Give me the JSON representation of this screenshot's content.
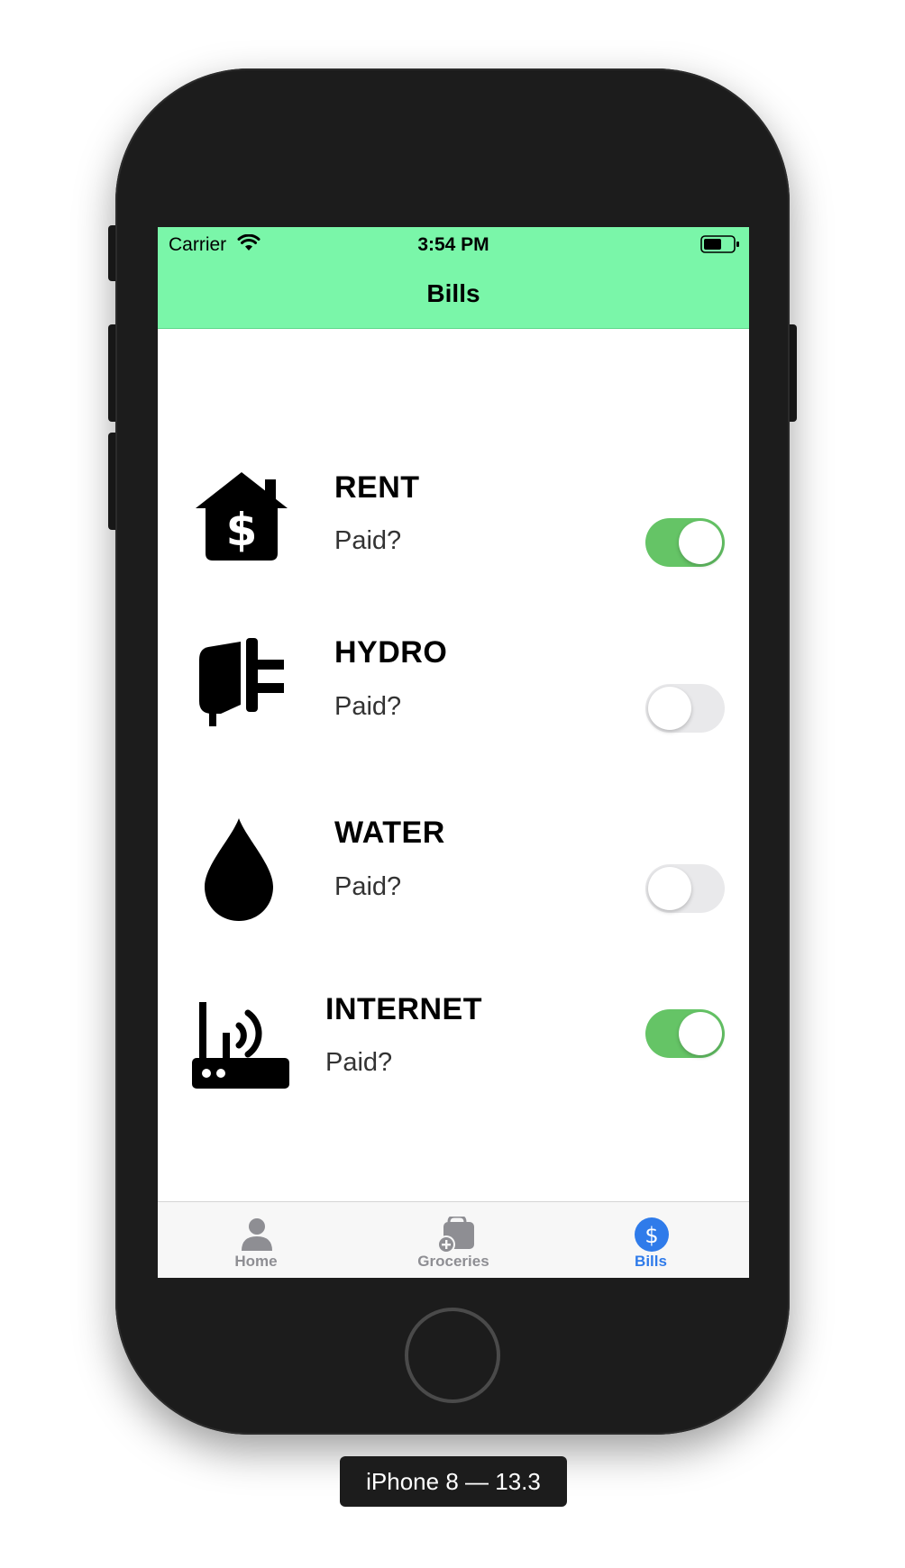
{
  "status_bar": {
    "carrier": "Carrier",
    "time": "3:54 PM"
  },
  "nav": {
    "title": "Bills"
  },
  "bills": [
    {
      "name": "RENT",
      "paid_label": "Paid?",
      "paid": true,
      "icon": "house-dollar-icon"
    },
    {
      "name": "HYDRO",
      "paid_label": "Paid?",
      "paid": false,
      "icon": "plug-icon"
    },
    {
      "name": "WATER",
      "paid_label": "Paid?",
      "paid": false,
      "icon": "water-drop-icon"
    },
    {
      "name": "INTERNET",
      "paid_label": "Paid?",
      "paid": true,
      "icon": "router-icon"
    }
  ],
  "tabs": [
    {
      "label": "Home",
      "icon": "person-icon",
      "active": false
    },
    {
      "label": "Groceries",
      "icon": "bag-add-icon",
      "active": false
    },
    {
      "label": "Bills",
      "icon": "dollar-circle-icon",
      "active": true
    }
  ],
  "device_label": "iPhone 8 — 13.3",
  "colors": {
    "nav_bar": "#7af6a9",
    "toggle_on": "#65c466",
    "toggle_off": "#e9e9eb",
    "tab_active": "#2f7bea",
    "tab_inactive": "#8e8e93"
  }
}
